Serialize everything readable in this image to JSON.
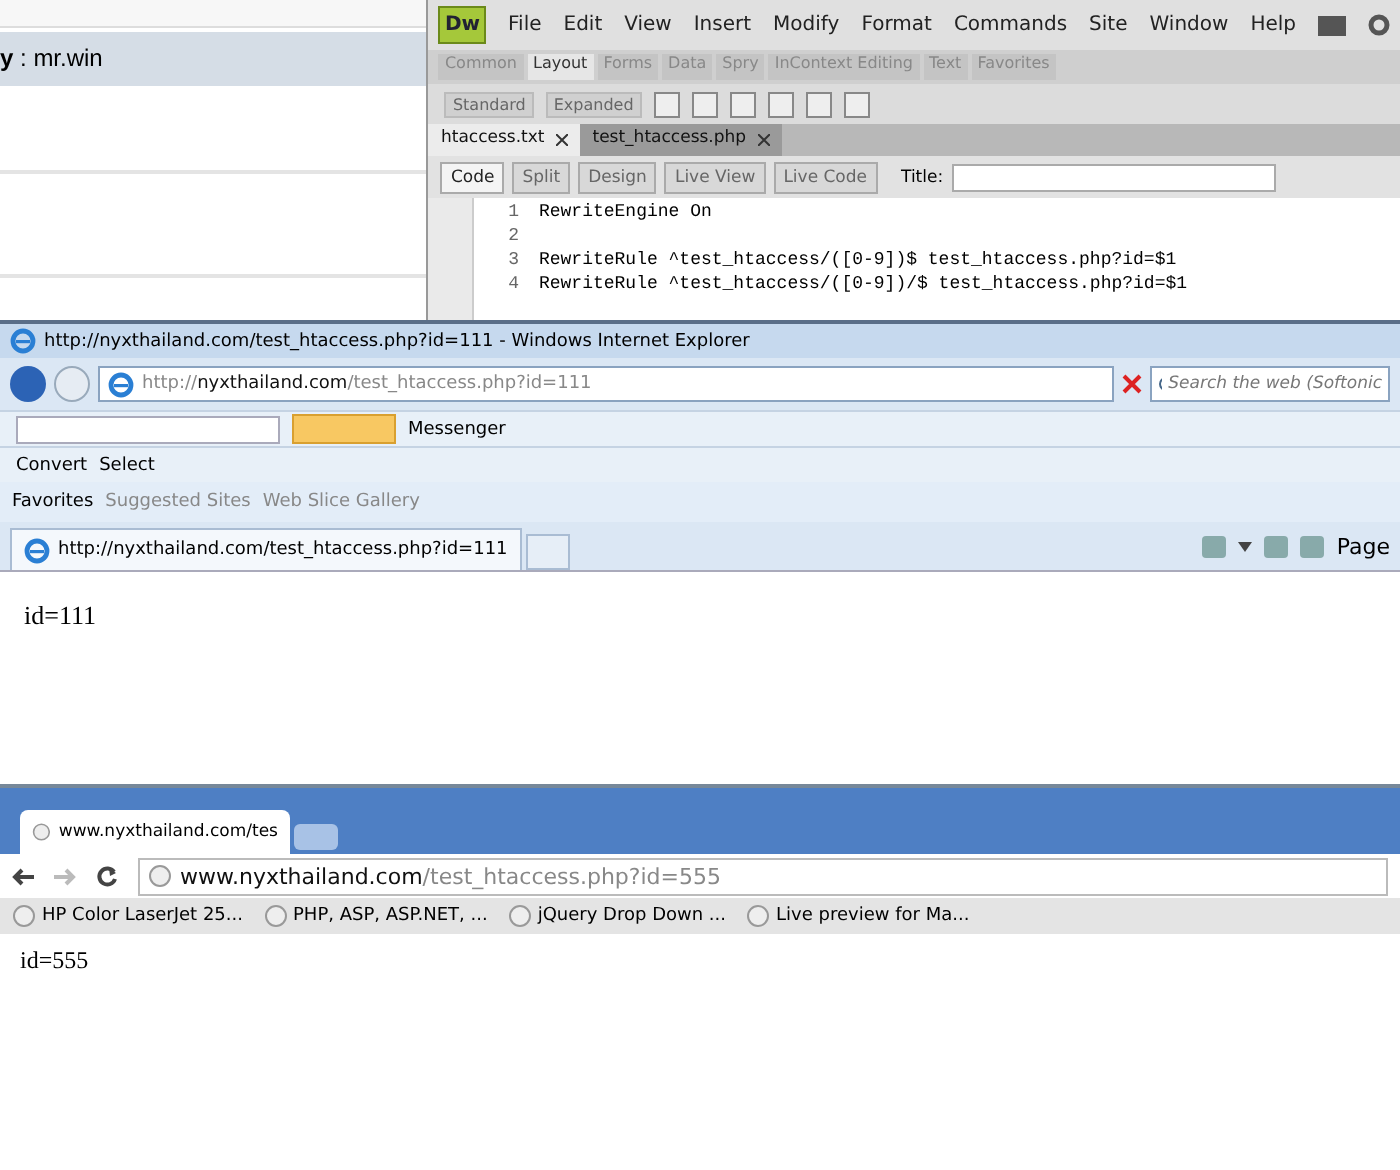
{
  "left_page": {
    "byline": "**y** : mr.win"
  },
  "dreamweaver": {
    "logo": "Dw",
    "menu": [
      "File",
      "Edit",
      "View",
      "Insert",
      "Modify",
      "Format",
      "Commands",
      "Site",
      "Window",
      "Help"
    ],
    "insert_tabs": [
      {
        "label": "Common",
        "selected": false
      },
      {
        "label": "Layout",
        "selected": true
      },
      {
        "label": "Forms",
        "selected": false
      },
      {
        "label": "Data",
        "selected": false
      },
      {
        "label": "Spry",
        "selected": false
      },
      {
        "label": "InContext Editing",
        "selected": false
      },
      {
        "label": "Text",
        "selected": false
      },
      {
        "label": "Favorites",
        "selected": false
      }
    ],
    "mode_buttons": [
      {
        "label": "Standard",
        "disabled": true
      },
      {
        "label": "Expanded",
        "disabled": true
      }
    ],
    "document_tabs": [
      {
        "label": "htaccess.txt",
        "selected": true
      },
      {
        "label": "test_htaccess.php",
        "selected": false
      }
    ],
    "view_buttons": [
      {
        "label": "Code",
        "disabled": false
      },
      {
        "label": "Split",
        "disabled": true
      },
      {
        "label": "Design",
        "disabled": true
      },
      {
        "label": "Live View",
        "disabled": true
      },
      {
        "label": "Live Code",
        "disabled": true
      }
    ],
    "title_label": "Title:",
    "lines": [
      {
        "number": "1",
        "code": "RewriteEngine On"
      },
      {
        "number": "2"
      },
      {
        "number": "3",
        "code": "RewriteRule ^test_htaccess/([0-9])$ test_htaccess.php?id=$1"
      },
      {
        "number": "4",
        "code": "RewriteRule ^test_htaccess/([0-9])/$ test_htaccess.php?id=$1"
      }
    ]
  },
  "ie": {
    "title": "http://nyxthailand.com/test_htaccess.php?id=111 - Windows Internet Explorer",
    "address": {
      "scheme": "http://",
      "host": "nyxthailand.com",
      "path": "/test_htaccess.php?id=111"
    },
    "search_placeholder": "Search the web (Softonic",
    "toolbar": [
      {
        "label": "Messenger"
      }
    ],
    "addon_bar": [
      {
        "label": "Convert"
      },
      {
        "label": "Select"
      }
    ],
    "favorites": [
      {
        "label": "Favorites",
        "disabled": false
      },
      {
        "label": "Suggested Sites",
        "disabled": true
      },
      {
        "label": "Web Slice Gallery",
        "disabled": true
      }
    ],
    "tab": "http://nyxthailand.com/test_htaccess.php?id=111",
    "page_menu": "Page",
    "content": "id=111"
  },
  "chrome": {
    "tab": "www.nyxthailand.com/tes",
    "address": {
      "host": "www.nyxthailand.com",
      "path": "/test_htaccess.php?id=555"
    },
    "bookmarks": [
      "HP Color LaserJet 25...",
      "PHP, ASP, ASP.NET, ...",
      "jQuery Drop Down ...",
      "Live preview for Ma..."
    ],
    "content": "id=555"
  }
}
